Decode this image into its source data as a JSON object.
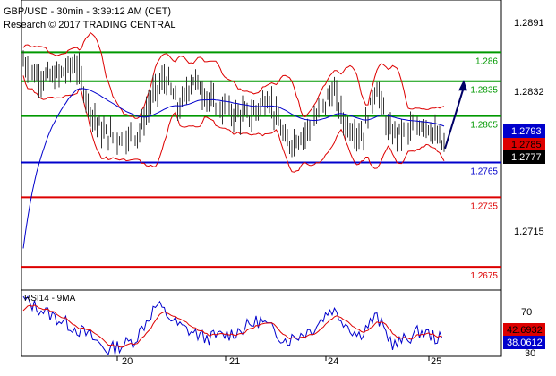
{
  "header": {
    "line1": "GBP/USD - 30min - 3:39:12 AM (CET)",
    "line2": "Research © 2017 TRADING CENTRAL"
  },
  "colors": {
    "green": "#009900",
    "red": "#dd0000",
    "blue": "#0000cc",
    "navy": "#000066",
    "bar": "#333333",
    "price_bg": "#000000",
    "red_tag": "#dd0000",
    "blue_tag": "#0000cc"
  },
  "chart_data": [
    {
      "type": "line",
      "title": "",
      "y_axis_ticks": [
        "1.2891",
        "1.2832",
        "1.2793",
        "1.2785",
        "1.2777",
        "1.2715"
      ],
      "x_axis_ticks": [
        "20",
        "21",
        "24",
        "25"
      ],
      "ylim": [
        1.2655,
        1.2905
      ],
      "current_price": "1.2777",
      "tags": [
        {
          "label": "1.2793",
          "value": 1.2793,
          "style": "blue"
        },
        {
          "label": "1.2785",
          "value": 1.2785,
          "style": "red"
        },
        {
          "label": "1.2777",
          "value": 1.2777,
          "style": "black"
        }
      ],
      "levels": [
        {
          "label": "1.286",
          "value": 1.286,
          "color": "green"
        },
        {
          "label": "1.2835",
          "value": 1.2835,
          "color": "green"
        },
        {
          "label": "1.2805",
          "value": 1.2805,
          "color": "green"
        },
        {
          "label": "1.2765",
          "value": 1.2765,
          "color": "blue"
        },
        {
          "label": "1.2735",
          "value": 1.2735,
          "color": "red"
        },
        {
          "label": "1.2675",
          "value": 1.2675,
          "color": "red"
        }
      ],
      "forecast_arrow": {
        "from": 1.2777,
        "to": 1.2833
      }
    },
    {
      "type": "line",
      "title": "RSI14 - 9MA",
      "y_axis_ticks": [
        "70",
        "30"
      ],
      "ylim": [
        25,
        80
      ],
      "tags": [
        {
          "label": "42.6932",
          "value": 42.6932,
          "style": "red"
        },
        {
          "label": "38.0612",
          "value": 38.0612,
          "style": "blue"
        }
      ]
    }
  ]
}
